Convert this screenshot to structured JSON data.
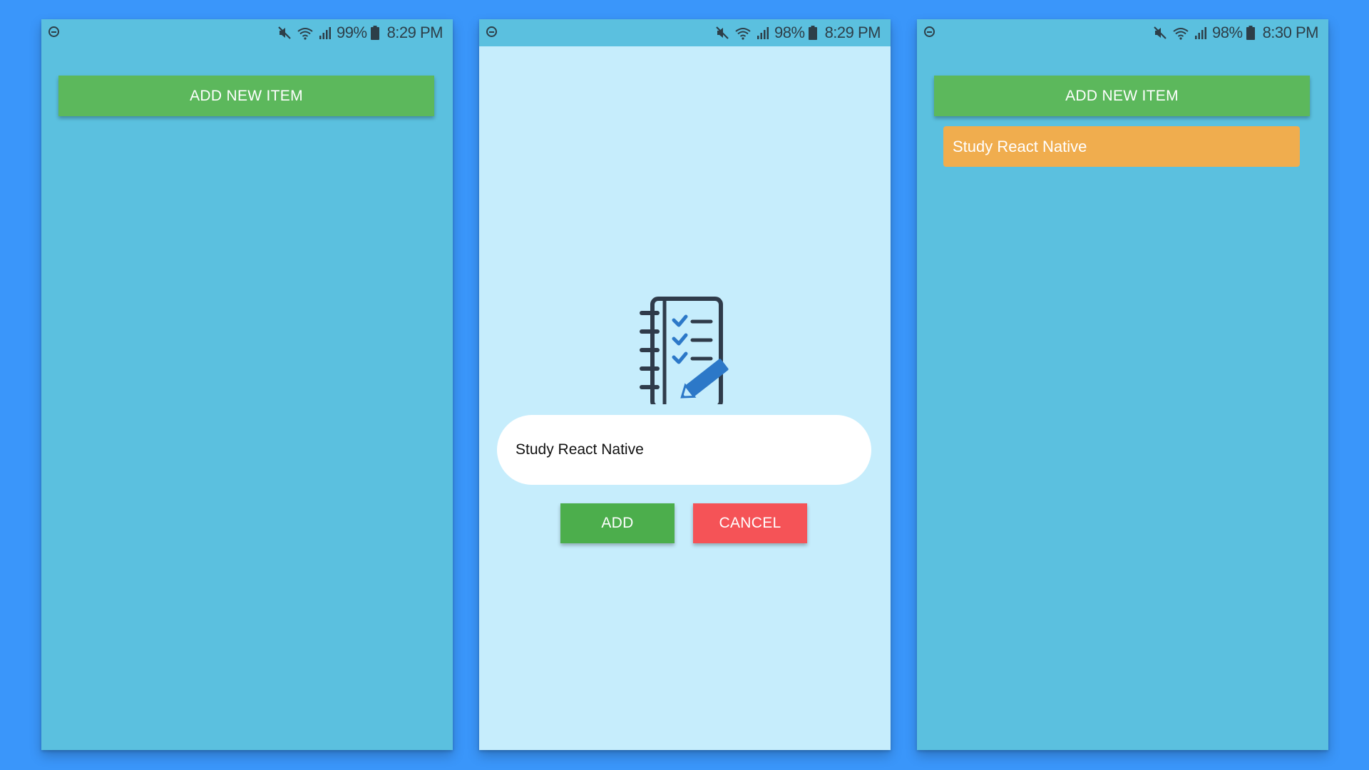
{
  "colors": {
    "background": "#3a96fa",
    "screen": "#5bc0df",
    "modal": "#c6edfc",
    "add_item_button": "#5cb85c",
    "todo_item": "#f0ad4e",
    "add_button": "#4cae4c",
    "cancel_button": "#f55357",
    "logo_dark": "#2f3b4a",
    "logo_blue": "#2c78c8"
  },
  "screens": [
    {
      "status": {
        "battery": "99%",
        "time": "8:29 PM"
      },
      "add_item_label": "ADD NEW ITEM"
    },
    {
      "status": {
        "battery": "98%",
        "time": "8:29 PM"
      },
      "logo_icon": "checklist-notebook-pencil-icon",
      "input_value": "Study React Native",
      "add_label": "ADD",
      "cancel_label": "CANCEL"
    },
    {
      "status": {
        "battery": "98%",
        "time": "8:30 PM"
      },
      "add_item_label": "ADD NEW ITEM",
      "items": [
        {
          "text": "Study React Native"
        }
      ]
    }
  ],
  "status_icons": [
    "do-not-disturb-icon",
    "mute-icon",
    "wifi-icon",
    "signal-icon",
    "battery-icon"
  ]
}
